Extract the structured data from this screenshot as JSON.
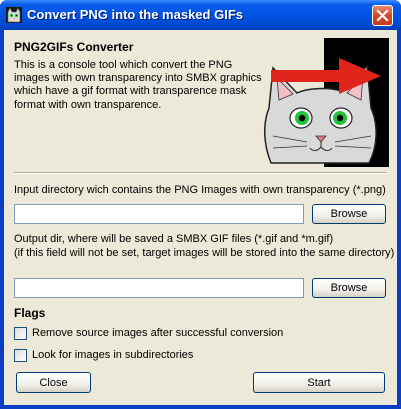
{
  "window": {
    "title": "Convert PNG into the masked GIFs"
  },
  "header": {
    "heading": "PNG2GIFs Converter",
    "description": "This is a console tool which convert the PNG images with own transparency into SMBX graphics which have a gif format with transparence mask format with own transparence."
  },
  "input_dir": {
    "label": "Input directory wich contains the PNG Images with own transparency (*.png)",
    "value": "",
    "browse_label": "Browse"
  },
  "output_dir": {
    "label": "Output dir, where will be saved a SMBX GIF files (*.gif and *m.gif)\n(if this field will not be set, target images will be stored into the same directory)",
    "value": "",
    "browse_label": "Browse"
  },
  "flags": {
    "heading": "Flags",
    "options": [
      {
        "label": "Remove source images after successful conversion",
        "checked": false
      },
      {
        "label": "Look for images in subdirectories",
        "checked": false
      }
    ]
  },
  "actions": {
    "close_label": "Close",
    "start_label": "Start"
  },
  "icons": {
    "app": "cat-icon",
    "close": "close-icon",
    "banner": "cat-with-arrow-illustration"
  },
  "colors": {
    "titlebar": "#0054e3",
    "dialog_bg": "#ece9d8",
    "close_button": "#d4482b",
    "arrow": "#e0241c",
    "eyes": "#22c33a"
  }
}
